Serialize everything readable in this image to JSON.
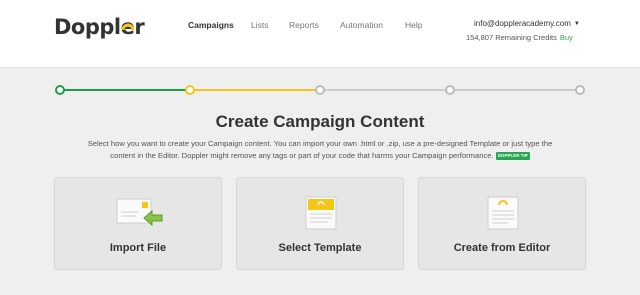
{
  "header": {
    "logo_text": "Doppler",
    "nav": [
      {
        "label": "Campaigns",
        "active": true
      },
      {
        "label": "Lists",
        "active": false
      },
      {
        "label": "Reports",
        "active": false
      },
      {
        "label": "Automation",
        "active": false
      },
      {
        "label": "Help",
        "active": false
      }
    ],
    "account_email": "info@doppleracademy.com",
    "credits_text": "154,807 Remaining Credits",
    "buy_label": "Buy"
  },
  "steps": {
    "total": 5,
    "current": 2,
    "colors": {
      "done": "#1e9b48",
      "current": "#f5c518",
      "pending": "#bbbbbb"
    }
  },
  "main": {
    "title": "Create Campaign Content",
    "description_line1": "Select how you want to create your Campaign content. You can import your own .html or .zip, use a pre-designed Template or just type the",
    "description_line2": "content in the Editor. Doppler might remove any tags or part of your code that harms your Campaign performance.",
    "tip_badge": "DOPPLER TIP"
  },
  "options": [
    {
      "label": "Import File",
      "icon": "import-file-icon"
    },
    {
      "label": "Select Template",
      "icon": "template-icon"
    },
    {
      "label": "Create from Editor",
      "icon": "editor-icon"
    }
  ],
  "colors": {
    "brand_yellow": "#f5c518",
    "green": "#2aa551",
    "background": "#efefef"
  }
}
